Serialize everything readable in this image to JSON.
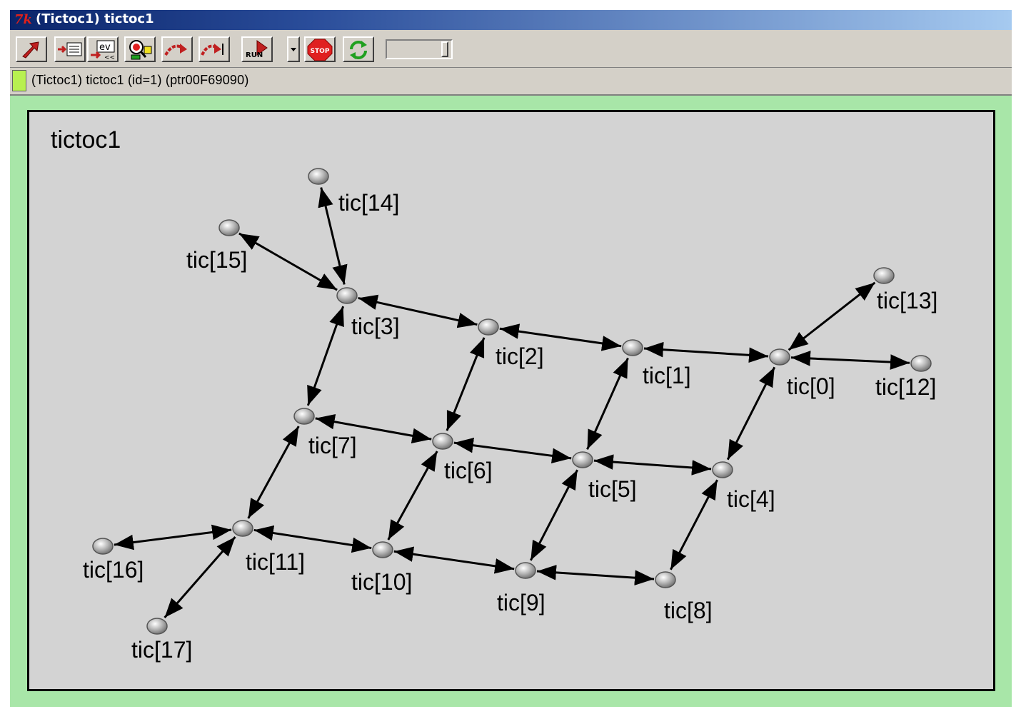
{
  "window": {
    "title": "(Tictoc1) tictoc1",
    "title_icon": "tk-icon"
  },
  "toolbar": {
    "buttons": [
      {
        "name": "step-up-icon"
      },
      {
        "name": "module-output-icon"
      },
      {
        "name": "event-log-icon",
        "label": "ev"
      },
      {
        "name": "inspect-icon"
      },
      {
        "name": "step-icon"
      },
      {
        "name": "fast-step-icon"
      },
      {
        "name": "run-icon",
        "label": "RUN"
      },
      {
        "name": "stop-icon",
        "label": "STOP"
      },
      {
        "name": "refresh-icon"
      }
    ],
    "speed_slider_value": 1.0
  },
  "infobar": {
    "text": "(Tictoc1) tictoc1  (id=1)  (ptr00F69090)",
    "swatch_color": "#b8f050"
  },
  "canvas": {
    "module_name": "tictoc1",
    "background": "#a8e6a8",
    "module_fill": "#d3d3d3",
    "nodes": [
      {
        "id": "tic[0]",
        "label": "tic[0]"
      },
      {
        "id": "tic[1]",
        "label": "tic[1]"
      },
      {
        "id": "tic[2]",
        "label": "tic[2]"
      },
      {
        "id": "tic[3]",
        "label": "tic[3]"
      },
      {
        "id": "tic[4]",
        "label": "tic[4]"
      },
      {
        "id": "tic[5]",
        "label": "tic[5]"
      },
      {
        "id": "tic[6]",
        "label": "tic[6]"
      },
      {
        "id": "tic[7]",
        "label": "tic[7]"
      },
      {
        "id": "tic[8]",
        "label": "tic[8]"
      },
      {
        "id": "tic[9]",
        "label": "tic[9]"
      },
      {
        "id": "tic[10]",
        "label": "tic[10]"
      },
      {
        "id": "tic[11]",
        "label": "tic[11]"
      },
      {
        "id": "tic[12]",
        "label": "tic[12]"
      },
      {
        "id": "tic[13]",
        "label": "tic[13]"
      },
      {
        "id": "tic[14]",
        "label": "tic[14]"
      },
      {
        "id": "tic[15]",
        "label": "tic[15]"
      },
      {
        "id": "tic[16]",
        "label": "tic[16]"
      },
      {
        "id": "tic[17]",
        "label": "tic[17]"
      }
    ],
    "links": [
      [
        "tic[0]",
        "tic[1]"
      ],
      [
        "tic[1]",
        "tic[2]"
      ],
      [
        "tic[2]",
        "tic[3]"
      ],
      [
        "tic[0]",
        "tic[12]"
      ],
      [
        "tic[0]",
        "tic[13]"
      ],
      [
        "tic[0]",
        "tic[4]"
      ],
      [
        "tic[1]",
        "tic[5]"
      ],
      [
        "tic[2]",
        "tic[6]"
      ],
      [
        "tic[3]",
        "tic[7]"
      ],
      [
        "tic[3]",
        "tic[14]"
      ],
      [
        "tic[3]",
        "tic[15]"
      ],
      [
        "tic[4]",
        "tic[5]"
      ],
      [
        "tic[5]",
        "tic[6]"
      ],
      [
        "tic[6]",
        "tic[7]"
      ],
      [
        "tic[4]",
        "tic[8]"
      ],
      [
        "tic[5]",
        "tic[9]"
      ],
      [
        "tic[6]",
        "tic[10]"
      ],
      [
        "tic[7]",
        "tic[11]"
      ],
      [
        "tic[8]",
        "tic[9]"
      ],
      [
        "tic[9]",
        "tic[10]"
      ],
      [
        "tic[10]",
        "tic[11]"
      ],
      [
        "tic[11]",
        "tic[16]"
      ],
      [
        "tic[11]",
        "tic[17]"
      ]
    ]
  }
}
